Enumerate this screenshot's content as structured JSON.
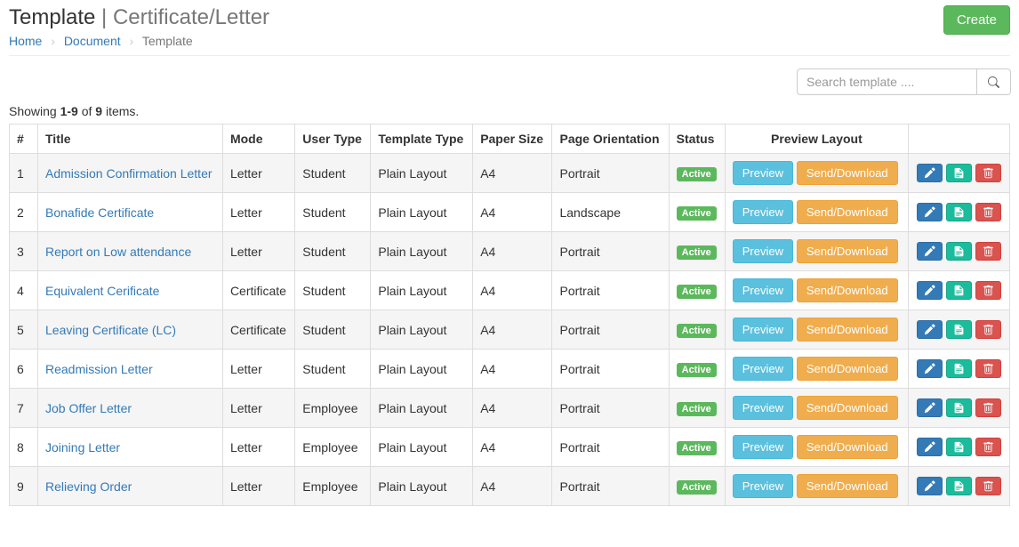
{
  "header": {
    "title_main": "Template",
    "title_sep": " | ",
    "title_sub": "Certificate/Letter",
    "create_button": "Create"
  },
  "breadcrumb": {
    "home": "Home",
    "document": "Document",
    "current": "Template"
  },
  "search": {
    "placeholder": "Search template ...."
  },
  "summary": {
    "prefix": "Showing ",
    "range": "1-9",
    "middle": " of ",
    "total": "9",
    "suffix": " items."
  },
  "columns": {
    "num": "#",
    "title": "Title",
    "mode": "Mode",
    "user_type": "User Type",
    "template_type": "Template Type",
    "paper_size": "Paper Size",
    "page_orientation": "Page Orientation",
    "status": "Status",
    "preview_layout": "Preview Layout"
  },
  "labels": {
    "preview": "Preview",
    "send_download": "Send/Download",
    "active": "Active"
  },
  "rows": [
    {
      "num": "1",
      "title": "Admission Confirmation Letter",
      "mode": "Letter",
      "user_type": "Student",
      "template_type": "Plain Layout",
      "paper_size": "A4",
      "page_orientation": "Portrait",
      "status": "Active"
    },
    {
      "num": "2",
      "title": "Bonafide Certificate",
      "mode": "Letter",
      "user_type": "Student",
      "template_type": "Plain Layout",
      "paper_size": "A4",
      "page_orientation": "Landscape",
      "status": "Active"
    },
    {
      "num": "3",
      "title": "Report on Low attendance",
      "mode": "Letter",
      "user_type": "Student",
      "template_type": "Plain Layout",
      "paper_size": "A4",
      "page_orientation": "Portrait",
      "status": "Active"
    },
    {
      "num": "4",
      "title": "Equivalent Cerificate",
      "mode": "Certificate",
      "user_type": "Student",
      "template_type": "Plain Layout",
      "paper_size": "A4",
      "page_orientation": "Portrait",
      "status": "Active"
    },
    {
      "num": "5",
      "title": "Leaving Certificate (LC)",
      "mode": "Certificate",
      "user_type": "Student",
      "template_type": "Plain Layout",
      "paper_size": "A4",
      "page_orientation": "Portrait",
      "status": "Active"
    },
    {
      "num": "6",
      "title": "Readmission Letter",
      "mode": "Letter",
      "user_type": "Student",
      "template_type": "Plain Layout",
      "paper_size": "A4",
      "page_orientation": "Portrait",
      "status": "Active"
    },
    {
      "num": "7",
      "title": "Job Offer Letter",
      "mode": "Letter",
      "user_type": "Employee",
      "template_type": "Plain Layout",
      "paper_size": "A4",
      "page_orientation": "Portrait",
      "status": "Active"
    },
    {
      "num": "8",
      "title": "Joining Letter",
      "mode": "Letter",
      "user_type": "Employee",
      "template_type": "Plain Layout",
      "paper_size": "A4",
      "page_orientation": "Portrait",
      "status": "Active"
    },
    {
      "num": "9",
      "title": "Relieving Order",
      "mode": "Letter",
      "user_type": "Employee",
      "template_type": "Plain Layout",
      "paper_size": "A4",
      "page_orientation": "Portrait",
      "status": "Active"
    }
  ]
}
